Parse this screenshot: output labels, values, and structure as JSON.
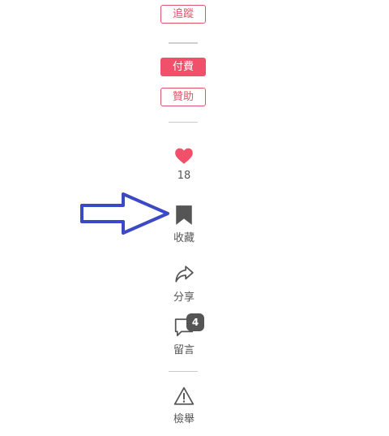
{
  "follow": {
    "label": "追蹤"
  },
  "pay": {
    "label": "付費"
  },
  "sponsor": {
    "label": "贊助"
  },
  "like": {
    "count": "18",
    "icon": "heart-icon",
    "color": "#f0506a"
  },
  "bookmark": {
    "label": "收藏",
    "icon": "bookmark-icon"
  },
  "share": {
    "label": "分享",
    "icon": "share-icon"
  },
  "comment": {
    "label": "留言",
    "count": "4",
    "icon": "comment-icon"
  },
  "report": {
    "label": "檢舉",
    "icon": "warning-icon"
  },
  "annotation": {
    "icon": "arrow-right-icon",
    "color": "#3b49c4"
  }
}
